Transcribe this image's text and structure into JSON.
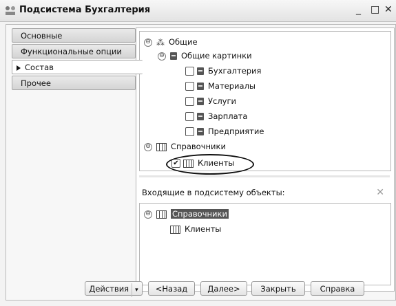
{
  "window": {
    "title": "Подсистема Бухгалтерия",
    "minimize": "_",
    "maximize": "□",
    "close": "✕"
  },
  "tabs": [
    {
      "label": "Основные"
    },
    {
      "label": "Функциональные опции"
    },
    {
      "label": "Состав",
      "active": true
    },
    {
      "label": "Прочее"
    }
  ],
  "tree": {
    "root": {
      "label": "Общие",
      "expanded": true
    },
    "pictures": {
      "label": "Общие картинки",
      "expanded": true
    },
    "picture_items": [
      {
        "label": "Бухгалтерия",
        "checked": false
      },
      {
        "label": "Материалы",
        "checked": false
      },
      {
        "label": "Услуги",
        "checked": false
      },
      {
        "label": "Зарплата",
        "checked": false
      },
      {
        "label": "Предприятие",
        "checked": false
      }
    ],
    "catalogs": {
      "label": "Справочники",
      "expanded": true
    },
    "catalog_item": {
      "label": "Клиенты",
      "checked": true
    }
  },
  "incoming": {
    "label": "Входящие в подсистему объекты:",
    "delete_icon": "✕",
    "catalogs": {
      "label": "Справочники",
      "selected": true
    },
    "catalog_item": {
      "label": "Клиенты"
    }
  },
  "buttons": {
    "actions": "Действия",
    "actions_dropdown": "▾",
    "back": "<Назад",
    "next": "Далее>",
    "close": "Закрыть",
    "help": "Справка"
  },
  "glyphs": {
    "collapse": "⊖",
    "check": "✔"
  }
}
